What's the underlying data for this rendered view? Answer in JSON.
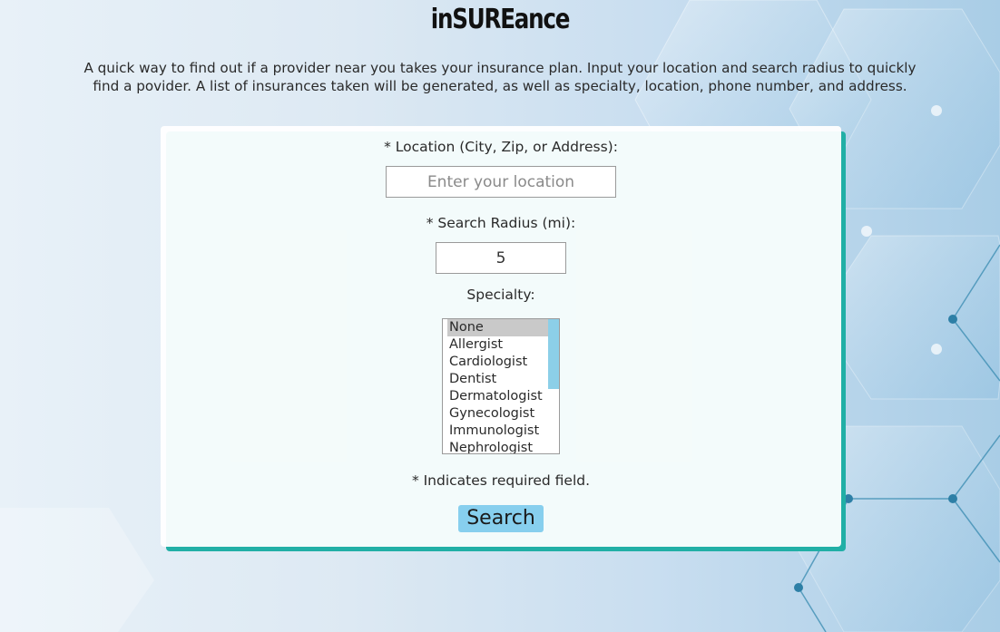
{
  "header": {
    "title": "inSUREance"
  },
  "intro": {
    "text": "A quick way to find out if a provider near you takes your insurance plan. Input your location and search radius to quickly find a povider. A list of insurances taken will be generated, as well as specialty, location, phone number, and address."
  },
  "form": {
    "location_label": "* Location (City, Zip, or Address):",
    "location_placeholder": "Enter your location",
    "location_value": "",
    "radius_label": "* Search Radius (mi):",
    "radius_value": "5",
    "specialty_label": "Specialty:",
    "specialty_selected": "None",
    "specialty_options": [
      "None",
      "Allergist",
      "Cardiologist",
      "Dentist",
      "Dermatologist",
      "Gynecologist",
      "Immunologist",
      "Nephrologist"
    ],
    "required_note": "* Indicates required field.",
    "search_label": "Search"
  },
  "colors": {
    "card_shadow": "#21afa6",
    "button": "#87cfee",
    "scroll_thumb": "#8ccfe8",
    "selected_option": "#c9c9c9"
  }
}
